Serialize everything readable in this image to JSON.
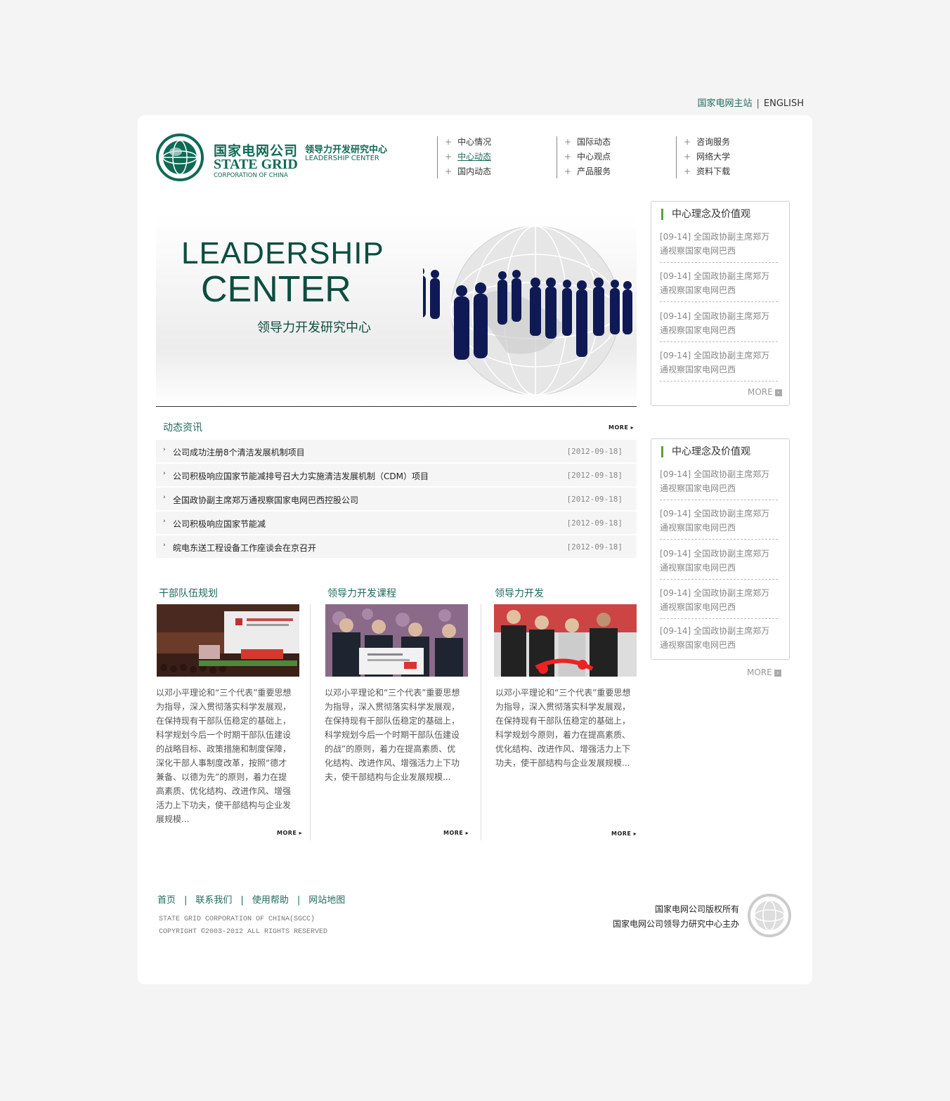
{
  "top_links": {
    "main_site": "国家电网主站",
    "separator": "|",
    "english": "ENGLISH"
  },
  "logo": {
    "company_cn": "国家电网公司",
    "company_en": "STATE GRID",
    "company_en_sub": "CORPORATION OF CHINA",
    "center_cn": "领导力开发研究中心",
    "center_en": "LEADERSHIP CENTER"
  },
  "nav": {
    "col1": [
      "中心情况",
      "中心动态",
      "国内动态"
    ],
    "col2": [
      "国际动态",
      "中心观点",
      "产品服务"
    ],
    "col3": [
      "咨询服务",
      "网络大学",
      "资料下载"
    ],
    "plus": "+"
  },
  "banner": {
    "line1": "LEADERSHIP",
    "line2": "CENTER",
    "subtitle": "领导力开发研究中心"
  },
  "news": {
    "title": "动态资讯",
    "more": "MORE ▸",
    "items": [
      {
        "text": "公司成功注册8个清洁发展机制项目",
        "date": "[2012-09-18]"
      },
      {
        "text": "公司积极响应国家节能减排号召大力实施清洁发展机制（CDM）项目",
        "date": "[2012-09-18]"
      },
      {
        "text": "全国政协副主席郑万通视察国家电网巴西控股公司",
        "date": "[2012-09-18]"
      },
      {
        "text": "公司积极响应国家节能减",
        "date": "[2012-09-18]"
      },
      {
        "text": "皖电东送工程设备工作座谈会在京召开",
        "date": "[2012-09-18]"
      }
    ],
    "arrow": "›"
  },
  "columns": [
    {
      "title": "干部队伍规划",
      "text": "以邓小平理论和“三个代表”重要思想为指导，深入贯彻落实科学发展观，在保持现有干部队伍稳定的基础上，科学规划今后一个时期干部队伍建设的战略目标、政策措施和制度保障，深化干部人事制度改革，按照“德才兼备、以德为先”的原则，着力在提高素质、优化结构、改进作风、增强活力上下功夫，使干部结构与企业发展规模...",
      "more": "MORE ▸"
    },
    {
      "title": "领导力开发课程",
      "text": "以邓小平理论和“三个代表”重要思想为指导，深入贯彻落实科学发展观，在保持现有干部队伍稳定的基础上，科学规划今后一个时期干部队伍建设的战”的原则，着力在提高素质、优化结构、改进作风、增强活力上下功夫，使干部结构与企业发展规模...",
      "more": "MORE ▸"
    },
    {
      "title": "领导力开发",
      "text": "以邓小平理论和“三个代表”重要思想为指导，深入贯彻落实科学发展观，在保持现有干部队伍稳定的基础上，科学规划今原则，着力在提高素质、优化结构、改进作风、增强活力上下功夫，使干部结构与企业发展规模...",
      "more": "MORE ▸"
    }
  ],
  "right_box_1": {
    "title": "中心理念及价值观",
    "items": [
      {
        "date": "[09-14]",
        "text": "全国政协副主席郑万通视察国家电网巴西"
      },
      {
        "date": "[09-14]",
        "text": "全国政协副主席郑万通视察国家电网巴西"
      },
      {
        "date": "[09-14]",
        "text": "全国政协副主席郑万通视察国家电网巴西"
      },
      {
        "date": "[09-14]",
        "text": "全国政协副主席郑万通视察国家电网巴西"
      }
    ],
    "more": "MORE"
  },
  "right_box_2": {
    "title": "中心理念及价值观",
    "items": [
      {
        "date": "[09-14]",
        "text": "全国政协副主席郑万通视察国家电网巴西"
      },
      {
        "date": "[09-14]",
        "text": "全国政协副主席郑万通视察国家电网巴西"
      },
      {
        "date": "[09-14]",
        "text": "全国政协副主席郑万通视察国家电网巴西"
      },
      {
        "date": "[09-14]",
        "text": "全国政协副主席郑万通视察国家电网巴西"
      },
      {
        "date": "[09-14]",
        "text": "全国政协副主席郑万通视察国家电网巴西"
      }
    ],
    "more": "MORE"
  },
  "footer": {
    "links": [
      "首页",
      "联系我们",
      "使用帮助",
      "网站地图"
    ],
    "separator": "|",
    "copy1": "STATE GRID CORPORATION OF CHINA(SGCC)",
    "copy2": "COPYRIGHT ©2003-2012 ALL RIGHTS RESERVED",
    "right1": "国家电网公司版权所有",
    "right2": "国家电网公司领导力研究中心主办"
  },
  "colors": {
    "brand_green": "#0f6a55",
    "accent_green": "#5aa23a",
    "link_green": "#1f6b5d"
  }
}
